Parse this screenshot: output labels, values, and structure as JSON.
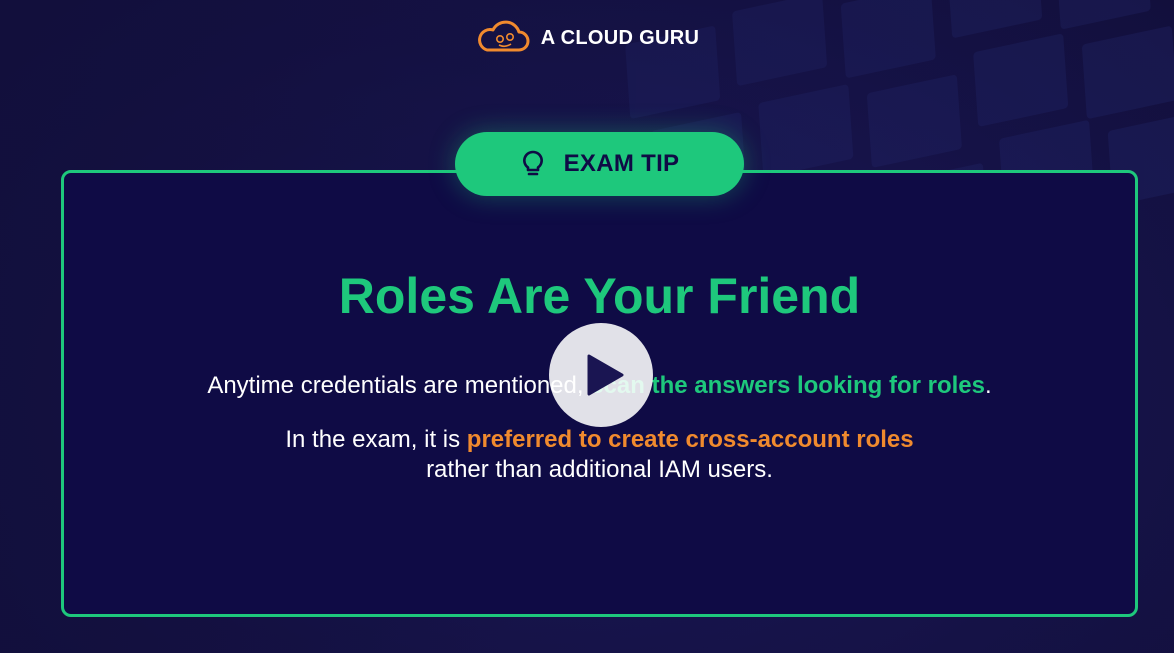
{
  "brand": {
    "name": "A CLOUD GURU",
    "logo_icon": "cloud-logo-icon",
    "logo_color": "#f08a2e"
  },
  "tip": {
    "icon": "lightbulb-icon",
    "label": "EXAM TIP"
  },
  "content": {
    "heading": "Roles Are Your Friend",
    "line1_prefix": "Anytime credentials are mentioned, ",
    "line1_highlight": "scan the answers looking for roles",
    "line1_suffix": ".",
    "line2_prefix": "In the exam, it is ",
    "line2_highlight": "preferred to create cross-account roles",
    "line3": "rather than additional IAM users."
  },
  "player": {
    "play_icon": "play-icon"
  },
  "colors": {
    "accent_green": "#1ec87c",
    "accent_orange": "#f08a2e",
    "card_background": "#0f0b45",
    "page_background": "#1a1552"
  }
}
